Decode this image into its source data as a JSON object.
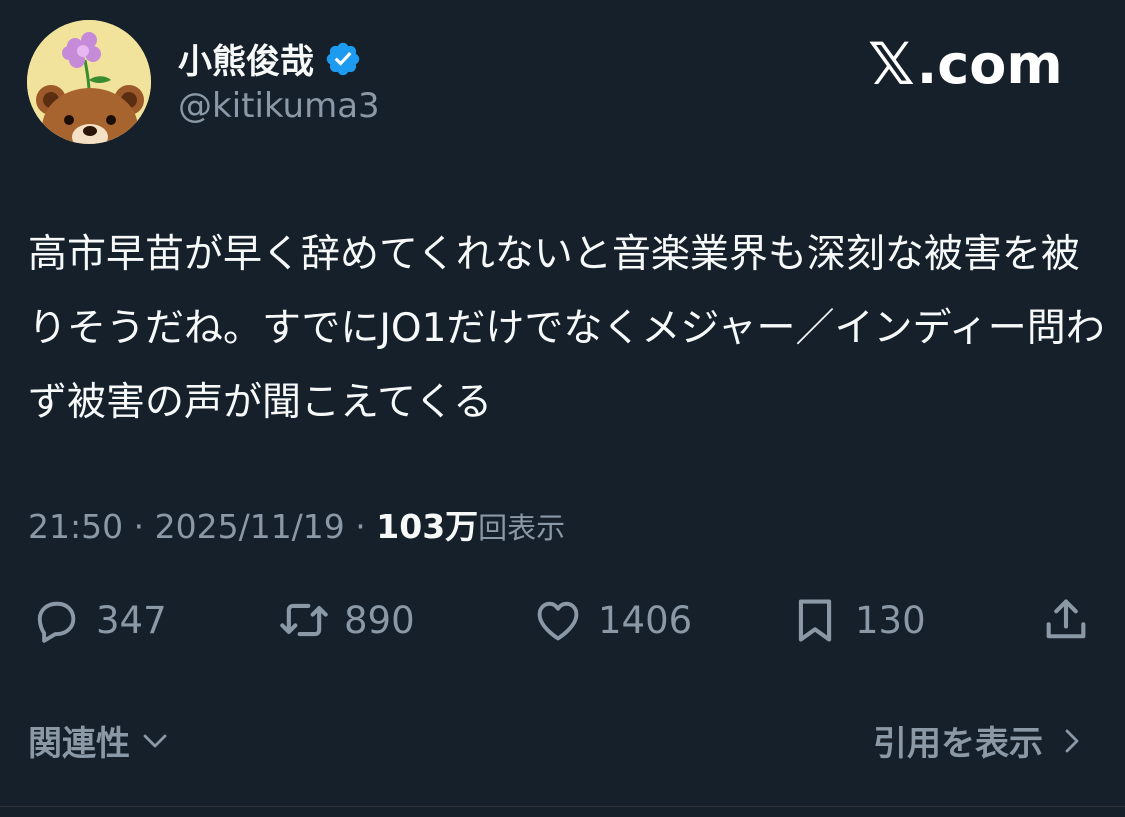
{
  "author": {
    "display_name": "小熊俊哉",
    "handle": "@kitikuma3",
    "verified_icon": "verified-badge-icon",
    "avatar_icon": "bear-with-flower-avatar"
  },
  "brand": {
    "mark": "𝕏",
    "text": ".com"
  },
  "tweet": {
    "text": "高市早苗が早く辞めてくれないと音楽業界も深刻な被害を被りそうだね。すでにJO1だけでなくメジャー／インディー問わず被害の声が聞こえてくる"
  },
  "meta": {
    "time": "21:50",
    "sep1": " · ",
    "date": "2025/11/19",
    "sep2": " · ",
    "views_count": "103万",
    "views_label": "回表示"
  },
  "actions": {
    "reply": {
      "icon": "reply-bubble-icon",
      "count": "347"
    },
    "retweet": {
      "icon": "retweet-icon",
      "count": "890"
    },
    "like": {
      "icon": "heart-icon",
      "count": "1406"
    },
    "bookmark": {
      "icon": "bookmark-icon",
      "count": "130"
    },
    "share": {
      "icon": "share-icon"
    }
  },
  "footer": {
    "related_label": "関連性",
    "quotes_label": "引用を表示"
  },
  "colors": {
    "background": "#15202b",
    "text_primary": "#f7f9f9",
    "text_secondary": "#8b98a5",
    "verified": "#1d9bf0"
  }
}
